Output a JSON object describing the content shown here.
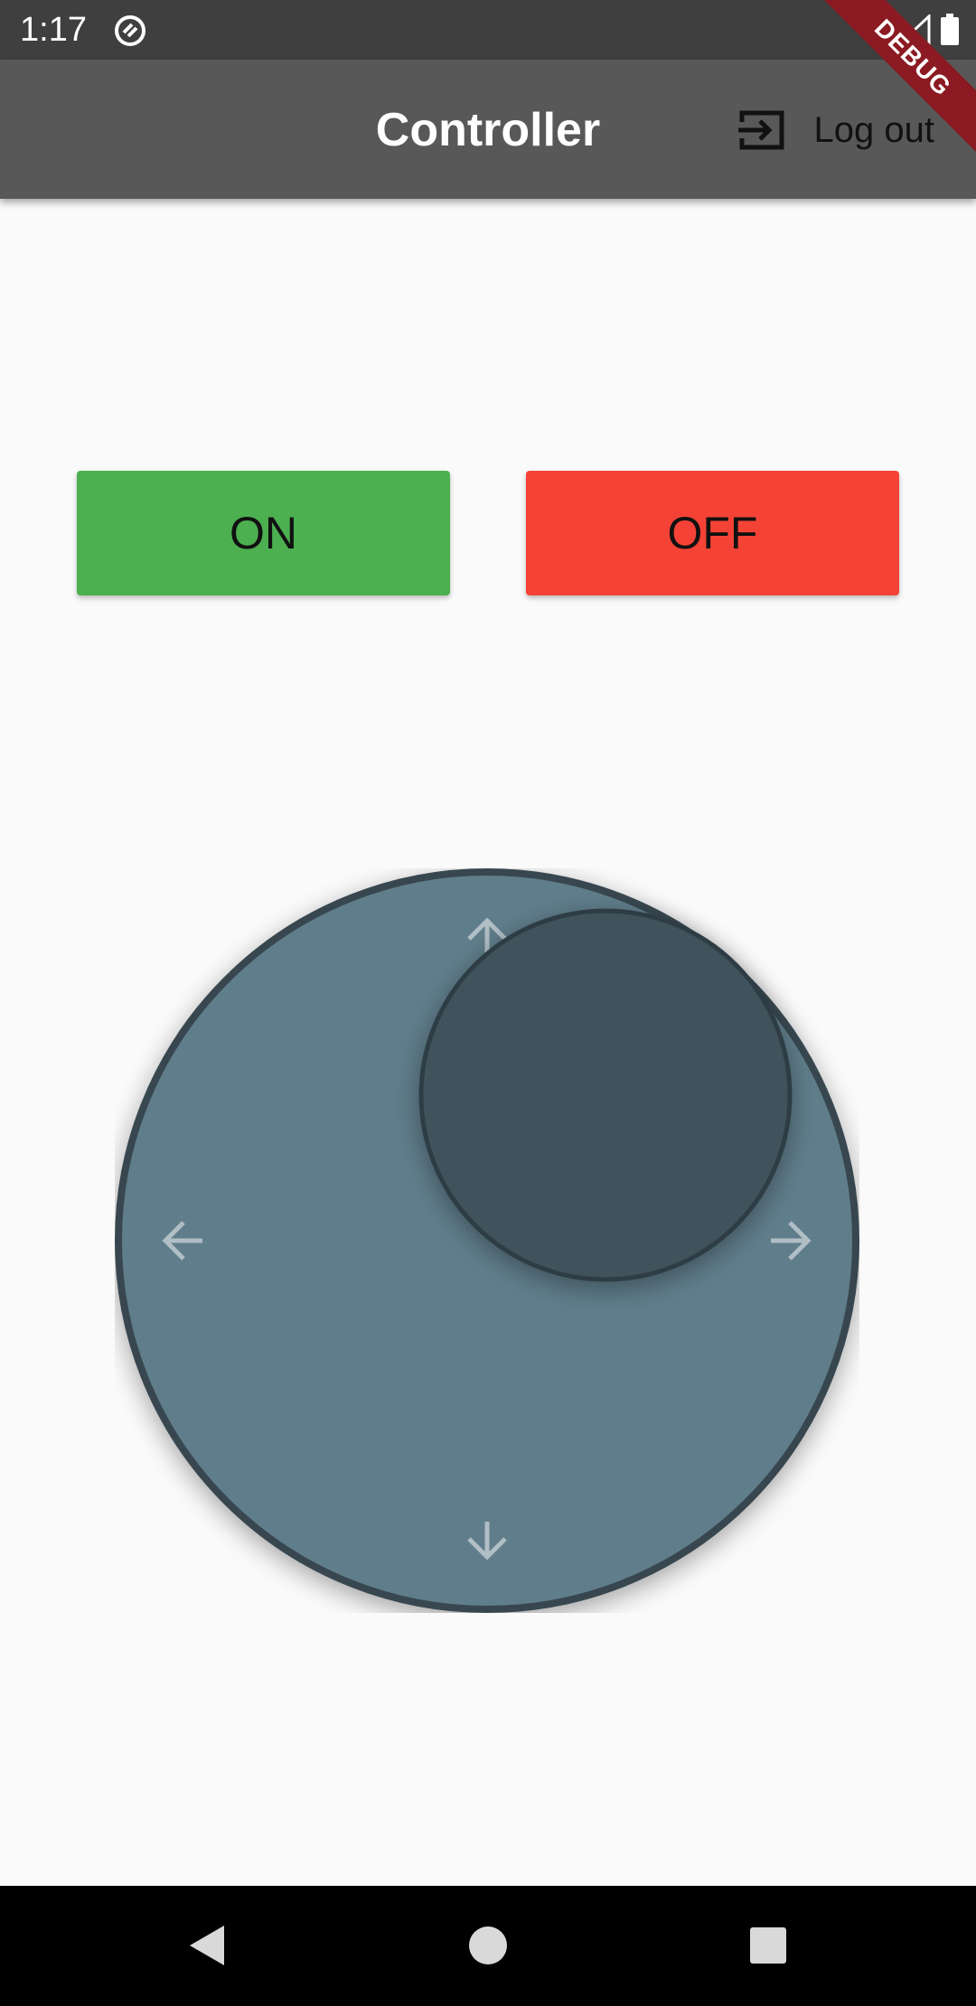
{
  "status_bar": {
    "time": "1:17"
  },
  "app_bar": {
    "title": "Controller",
    "logout_label": "Log out",
    "debug_banner": "DEBUG"
  },
  "buttons": {
    "on_label": "ON",
    "off_label": "OFF"
  },
  "joystick": {
    "arrows": [
      "arrow-up-icon",
      "arrow-down-icon",
      "arrow-left-icon",
      "arrow-right-icon"
    ]
  },
  "nav_bar": {
    "icons": [
      "back-icon",
      "home-icon",
      "recents-icon"
    ]
  },
  "colors": {
    "status_bar": "#3f3f3f",
    "app_bar": "#585858",
    "on_button": "#4caf50",
    "off_button": "#f44336",
    "joystick_base": "#607d8b",
    "joystick_knob": "#3f535c",
    "joystick_border": "#37474f"
  }
}
